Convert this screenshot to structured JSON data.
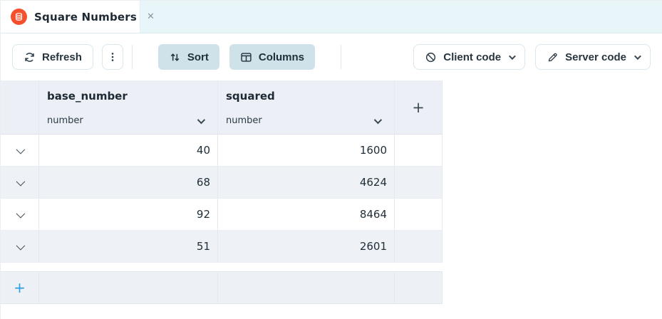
{
  "tab_bar": {
    "active_tab": {
      "title": "Square Numbers",
      "close_glyph": "✕",
      "icon": "database-icon"
    }
  },
  "toolbar": {
    "refresh_label": "Refresh",
    "sort_label": "Sort",
    "columns_label": "Columns",
    "client_code_label": "Client code",
    "server_code_label": "Server code",
    "icons": {
      "refresh": "refresh-icon",
      "menu": "kebab-menu-icon",
      "sort": "sort-arrows-icon",
      "columns": "columns-icon",
      "client_code": "slash-circle-icon",
      "server_code": "pencil-icon",
      "dropdown": "chevron-down-icon"
    }
  },
  "table": {
    "columns": [
      {
        "name": "base_number",
        "type": "number"
      },
      {
        "name": "squared",
        "type": "number"
      }
    ],
    "rows": [
      {
        "base_number": "40",
        "squared": "1600"
      },
      {
        "base_number": "68",
        "squared": "4624"
      },
      {
        "base_number": "92",
        "squared": "8464"
      },
      {
        "base_number": "51",
        "squared": "2601"
      }
    ],
    "add_column_label": "+",
    "add_row_label": "+",
    "row_expander_icon": "chevron-down-icon"
  },
  "colors": {
    "accent_orange": "#f4502e",
    "tab_bar_teal": "#e9f6f9",
    "filled_button": "#cfe1e9",
    "header_bg": "#ecf0f6",
    "alt_row_bg": "#eef1f6",
    "add_row_plus_blue": "#2d9fe0",
    "text_dark": "#1d2933"
  }
}
